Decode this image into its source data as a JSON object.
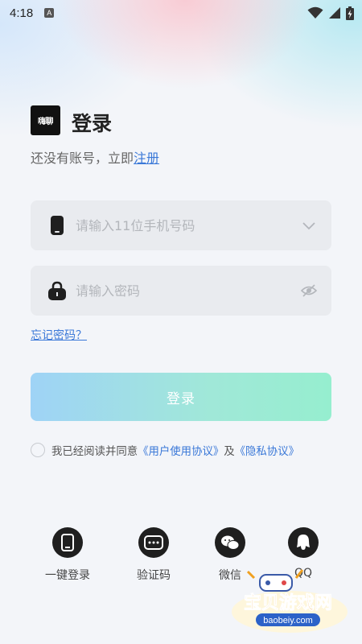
{
  "status_bar": {
    "time": "4:18",
    "badge": "A"
  },
  "logo": {
    "text": "嗨聊"
  },
  "header": {
    "title": "登录",
    "register_prompt": "还没有账号，立即",
    "register_link": "注册"
  },
  "form": {
    "phone_placeholder": "请输入11位手机号码",
    "password_placeholder": "请输入密码",
    "forgot_link": "忘记密码？",
    "login_button": "登录"
  },
  "agreement": {
    "prefix": "我已经阅读并同意",
    "user_agreement": "《用户使用协议》",
    "connector": "及",
    "privacy": "《隐私协议》"
  },
  "alt_login": [
    {
      "label": "一键登录",
      "icon": "phone-icon"
    },
    {
      "label": "验证码",
      "icon": "verification-code-icon"
    },
    {
      "label": "微信",
      "icon": "wechat-icon"
    },
    {
      "label": "QQ",
      "icon": "qq-icon"
    }
  ],
  "watermark": {
    "title": "宝贝游戏网",
    "url": "baobeiy.com"
  },
  "colors": {
    "link": "#3a78d8",
    "button_gradient_start": "#9fd3f6",
    "button_gradient_end": "#96eecf",
    "field_bg": "#e9ebef",
    "page_bg": "#f3f5f9"
  }
}
